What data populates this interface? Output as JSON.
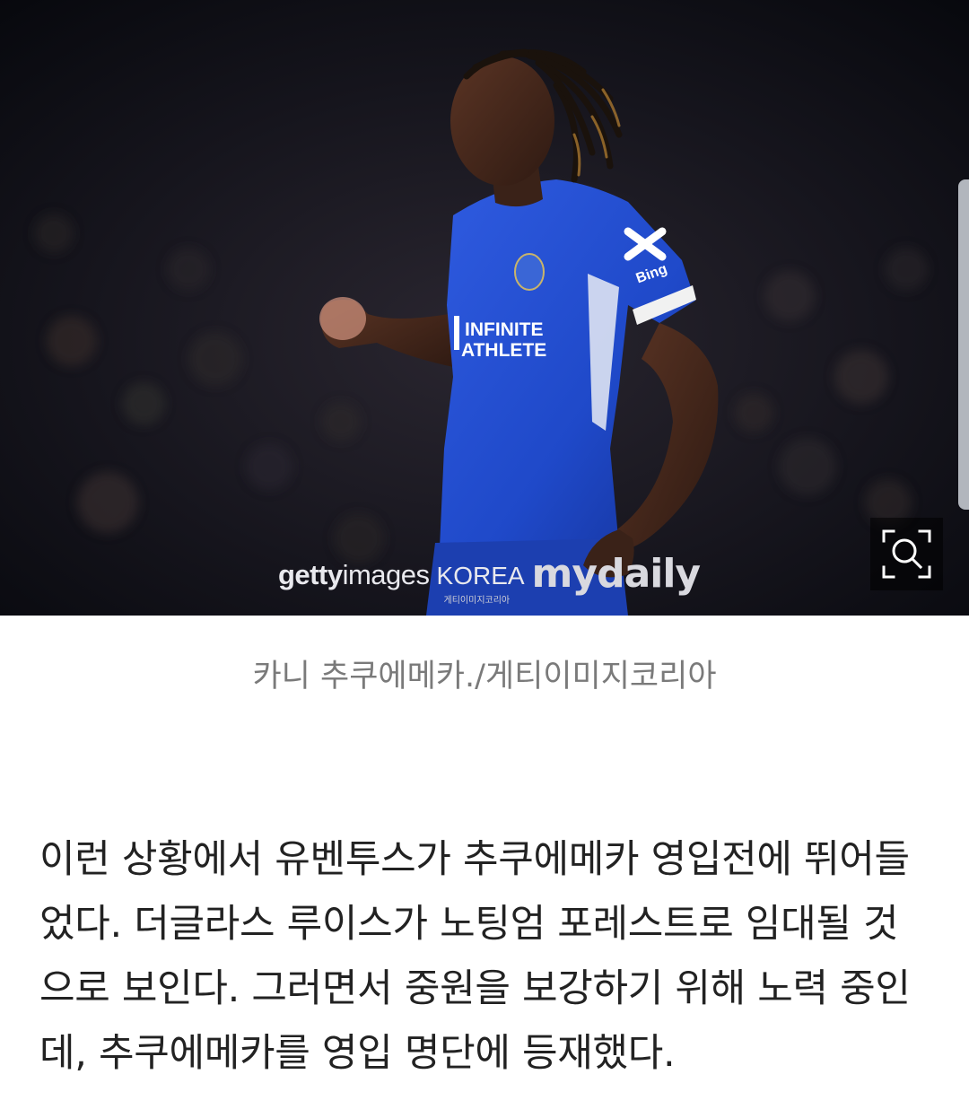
{
  "photo": {
    "watermark": {
      "getty_bold": "getty",
      "getty_light": "images",
      "korea": "KOREA",
      "korea_sub": "게티이미지코리아",
      "mydaily": "mydaily"
    },
    "jersey_sponsor_line1": "INFINITE",
    "jersey_sponsor_line2": "ATHLETE",
    "sleeve_text": "Bing",
    "zoom_icon": "zoom-magnifier-icon"
  },
  "caption": "카니 추쿠에메카./게티이미지코리아",
  "body_lines": [
    "이런 상황에서 유벤투스가 추쿠에메카 영입전에 뛰어들",
    "었다. 더글라스 루이스가 노팅엄 포레스트로 임대될 것",
    "으로 보인다. 그러면서 중원을 보강하기 위해 노력 중인",
    "데, 추쿠에메카를 영입 명단에 등재했다."
  ],
  "colors": {
    "jersey_blue": "#1f49c9",
    "caption_gray": "#7a7a7a",
    "body_text": "#222222"
  }
}
